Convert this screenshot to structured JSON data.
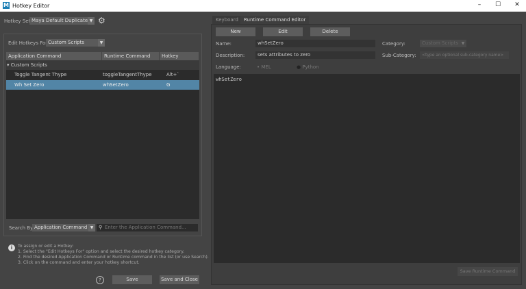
{
  "window": {
    "title": "Hotkey Editor",
    "logo": "M",
    "minimize": "–",
    "maximize": "☐",
    "close": "✕"
  },
  "hotkey_set": {
    "label": "Hotkey Set:",
    "value": "Maya Default Duplicate",
    "settings_icon": "gear-icon"
  },
  "edit_for": {
    "label": "Edit Hotkeys For:",
    "value": "Custom Scripts"
  },
  "table": {
    "columns": [
      "Application Command",
      "Runtime Command",
      "Hotkey"
    ],
    "group": "▾ Custom Scripts",
    "rows": [
      {
        "app": "Toggle Tangent Thype",
        "runtime": "toggleTangentThype",
        "hotkey": "Alt+`",
        "selected": false
      },
      {
        "app": "Wh Set Zero",
        "runtime": "whSetZero",
        "hotkey": "G",
        "selected": true
      }
    ]
  },
  "search": {
    "label": "Search By:",
    "mode": "Application Command",
    "placeholder": "Enter the Application Command..."
  },
  "help": {
    "lines": [
      "To assign or edit a Hotkey:",
      "1. Select the \"Edit Hotkeys For\" option and select the desired hotkey category.",
      "2. Find the desired Application Command or Runtime command in the list (or use Search).",
      "3. Click on the command and enter your hotkey shortcut."
    ]
  },
  "footer": {
    "help": "?",
    "save": "Save",
    "save_close": "Save and Close"
  },
  "tabs": [
    {
      "label": "Keyboard",
      "active": false
    },
    {
      "label": "Runtime Command Editor",
      "active": true
    }
  ],
  "editor": {
    "new": "New",
    "edit": "Edit",
    "delete": "Delete",
    "name_label": "Name:",
    "name": "whSetZero",
    "desc_label": "Description:",
    "desc": "sets attributes to zero",
    "category_label": "Category:",
    "category": "Custom Scripts",
    "subcat_label": "Sub-Category:",
    "subcat_placeholder": "<type an optional sub-category name>",
    "language_label": "Language:",
    "mel": "MEL",
    "python": "Python",
    "language_selected": "MEL",
    "code": "whSetZero",
    "save_runtime": "Save Runtime Command"
  },
  "colors": {
    "selection": "#5285a6",
    "accent": "#1b7fb5"
  }
}
